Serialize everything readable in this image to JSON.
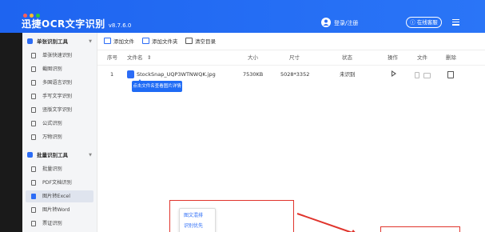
{
  "titlebar": {
    "app_title": "迅捷OCR文字识别",
    "version": "v8.7.6.0",
    "login": "登录/注册",
    "service_button": "在线客服"
  },
  "sidebar": {
    "groups": [
      {
        "label": "单张识别工具",
        "items": [
          {
            "label": "单张快速识别"
          },
          {
            "label": "截图识别"
          },
          {
            "label": "多国语言识别"
          },
          {
            "label": "手写文字识别"
          },
          {
            "label": "竖版文字识别"
          },
          {
            "label": "公式识别"
          },
          {
            "label": "万物识别"
          }
        ]
      },
      {
        "label": "批量识别工具",
        "items": [
          {
            "label": "批量识别"
          },
          {
            "label": "PDF文档识别"
          },
          {
            "label": "图片转Excel"
          },
          {
            "label": "图片转Word"
          },
          {
            "label": "票证识别"
          }
        ]
      }
    ]
  },
  "toolbar": {
    "add_file": "添加文件",
    "add_folder": "添加文件夹",
    "clear": "清空目录"
  },
  "table": {
    "headers": [
      "序号",
      "文件名",
      "大小",
      "尺寸",
      "状态",
      "操作",
      "文件",
      "删除"
    ],
    "rows": [
      {
        "index": "1",
        "filename": "StockSnap_UQP3WTNWQK.jpg",
        "size": "7530KB",
        "dimensions": "5028*3352",
        "status": "未识别"
      }
    ],
    "tooltip": "点击文件名查看图片详情"
  },
  "popup": {
    "items": [
      "图文混排",
      "识别优先"
    ]
  },
  "colors": {
    "accent": "#2b6cf6",
    "annotation_red": "#e0342c"
  }
}
